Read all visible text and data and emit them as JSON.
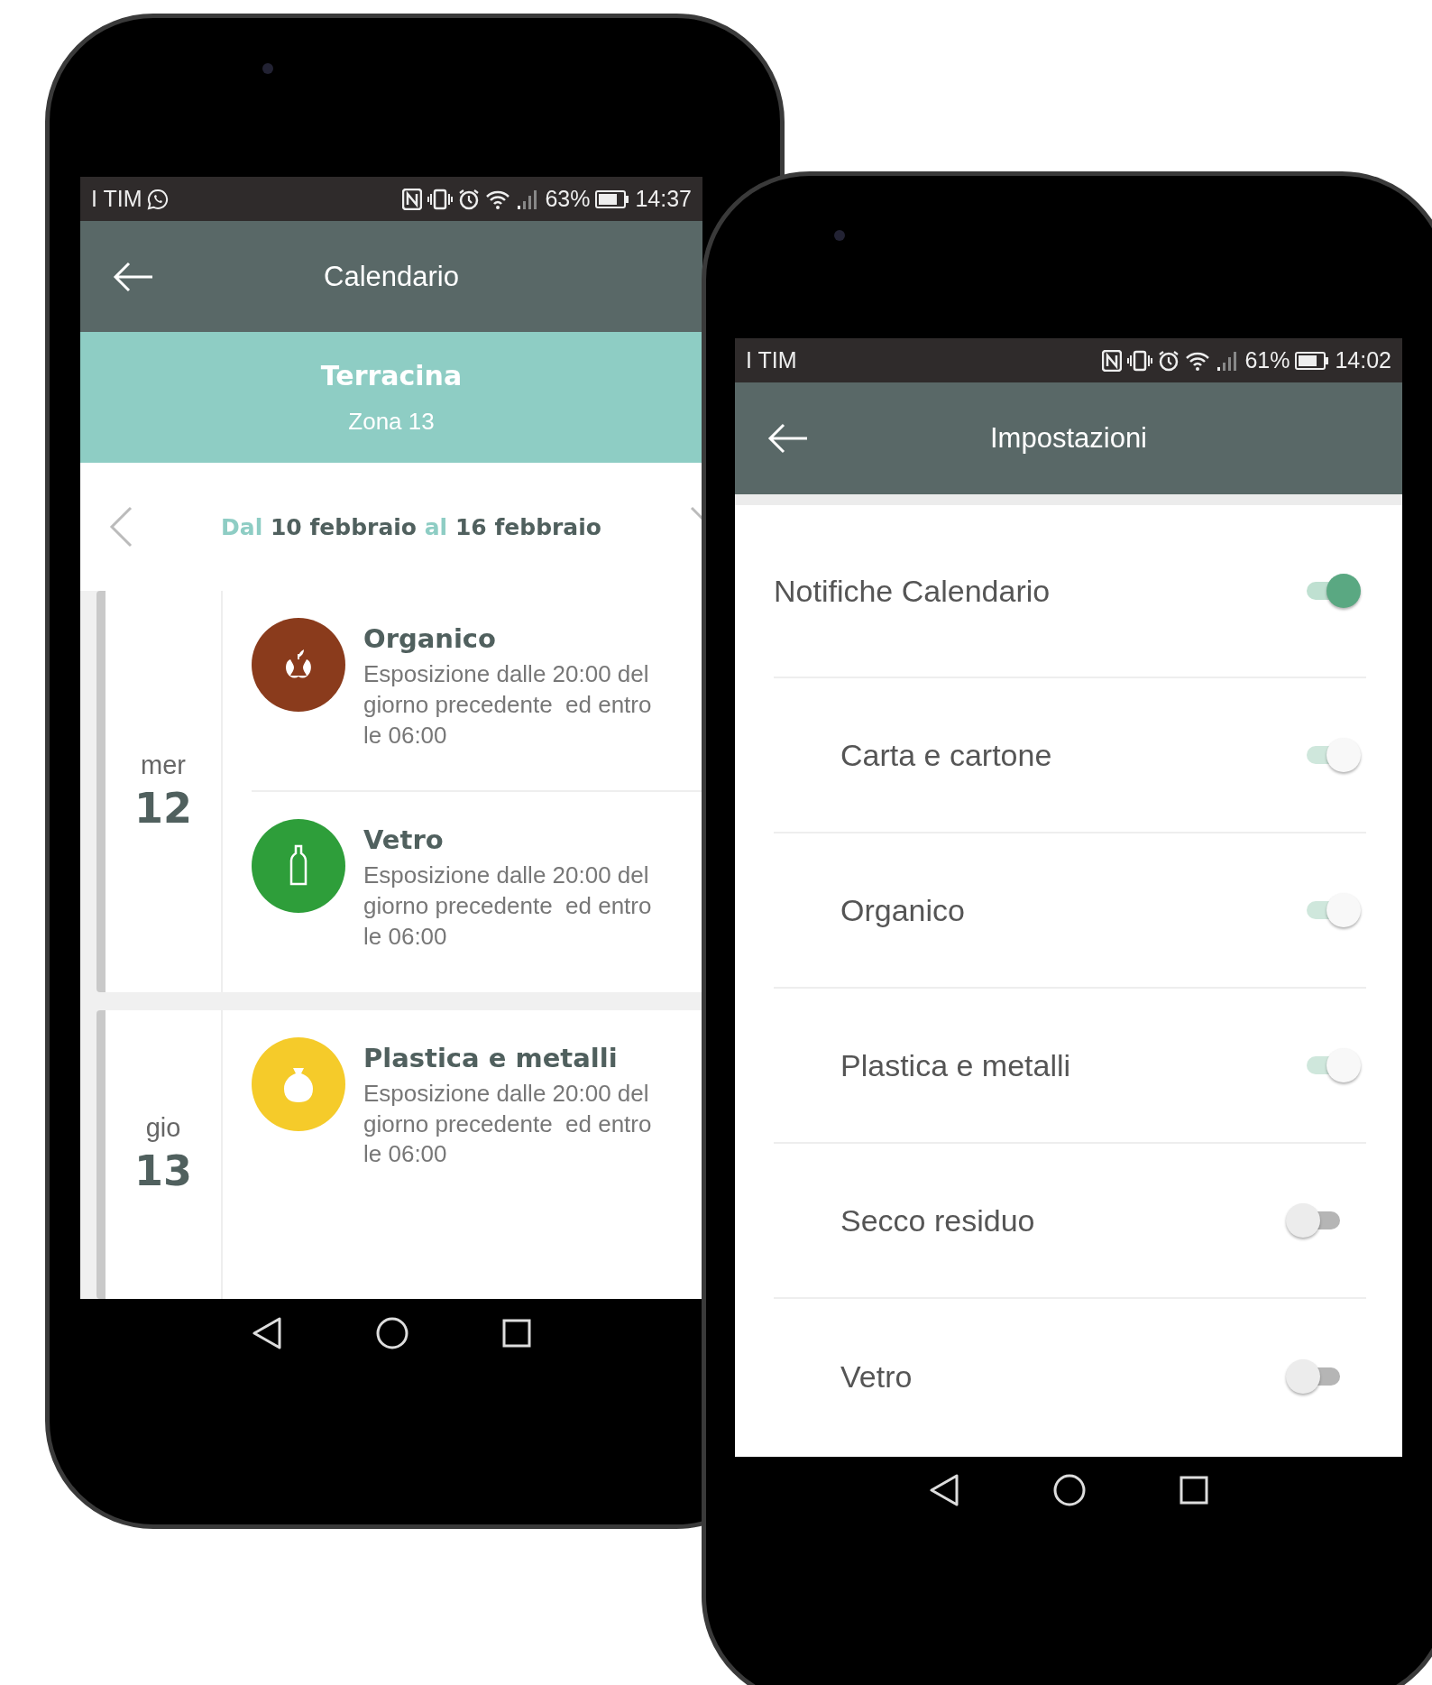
{
  "calendar_phone": {
    "status_bar": {
      "carrier": "I TIM",
      "battery": "63%",
      "time": "14:37"
    },
    "app_bar": {
      "title": "Calendario"
    },
    "location": {
      "city": "Terracina",
      "zone": "Zona 13"
    },
    "week_range": {
      "from_label": "Dal",
      "from_date": "10 febbraio",
      "to_label": "al",
      "to_date": "16 febbraio"
    },
    "days": [
      {
        "weekday": "mer",
        "day": "12",
        "collections": [
          {
            "kind": "organic",
            "title": "Organico",
            "color": "#8a3b1c",
            "description": "Esposizione dalle 20:00 del giorno precedente  ed entro le 06:00"
          },
          {
            "kind": "glass",
            "title": "Vetro",
            "color": "#2e9e3a",
            "description": "Esposizione dalle 20:00 del giorno precedente  ed entro le 06:00"
          }
        ]
      },
      {
        "weekday": "gio",
        "day": "13",
        "collections": [
          {
            "kind": "plastic",
            "title": "Plastica e metalli",
            "color": "#f5cb2a",
            "description": "Esposizione dalle 20:00 del giorno precedente  ed entro le 06:00"
          }
        ]
      }
    ]
  },
  "settings_phone": {
    "status_bar": {
      "carrier": "I TIM",
      "battery": "61%",
      "time": "14:02"
    },
    "app_bar": {
      "title": "Impostazioni"
    },
    "settings": [
      {
        "kind": "main",
        "label": "Notifiche Calendario",
        "on": true,
        "disabled": false
      },
      {
        "kind": "sub",
        "label": "Carta e cartone",
        "on": true,
        "disabled": true
      },
      {
        "kind": "sub",
        "label": "Organico",
        "on": true,
        "disabled": true
      },
      {
        "kind": "sub",
        "label": "Plastica e metalli",
        "on": true,
        "disabled": true
      },
      {
        "kind": "sub",
        "label": "Secco residuo",
        "on": false,
        "disabled": true
      },
      {
        "kind": "sub",
        "label": "Vetro",
        "on": false,
        "disabled": true
      }
    ]
  }
}
